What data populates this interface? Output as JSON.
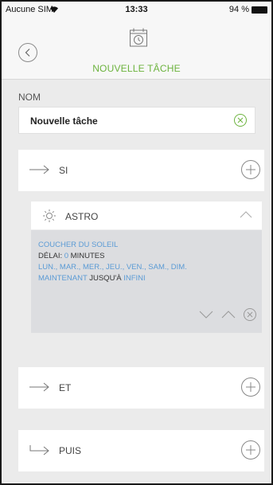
{
  "status_bar": {
    "carrier": "Aucune SIM",
    "time": "13:33",
    "battery": "94 %"
  },
  "header": {
    "title": "NOUVELLE TÂCHE",
    "icon": "calendar-clock-icon"
  },
  "name": {
    "label": "NOM",
    "value": "Nouvelle tâche"
  },
  "sections": {
    "si": {
      "label": "SI"
    },
    "et": {
      "label": "ET"
    },
    "puis": {
      "label": "PUIS"
    }
  },
  "condition": {
    "label": "ASTRO",
    "event": "COUCHER DU SOLEIL",
    "delay_label": "DÉLAI: ",
    "delay_value": "0",
    "delay_unit": " MINUTES",
    "days": "LUN., MAR., MER., JEU., VEN., SAM., DIM.",
    "period_start": "MAINTENANT",
    "period_join": " JUSQU'À ",
    "period_end": "INFINI"
  },
  "colors": {
    "accent_green": "#6cb33e",
    "link_blue": "#5b9bd5",
    "background": "#ebebeb"
  }
}
